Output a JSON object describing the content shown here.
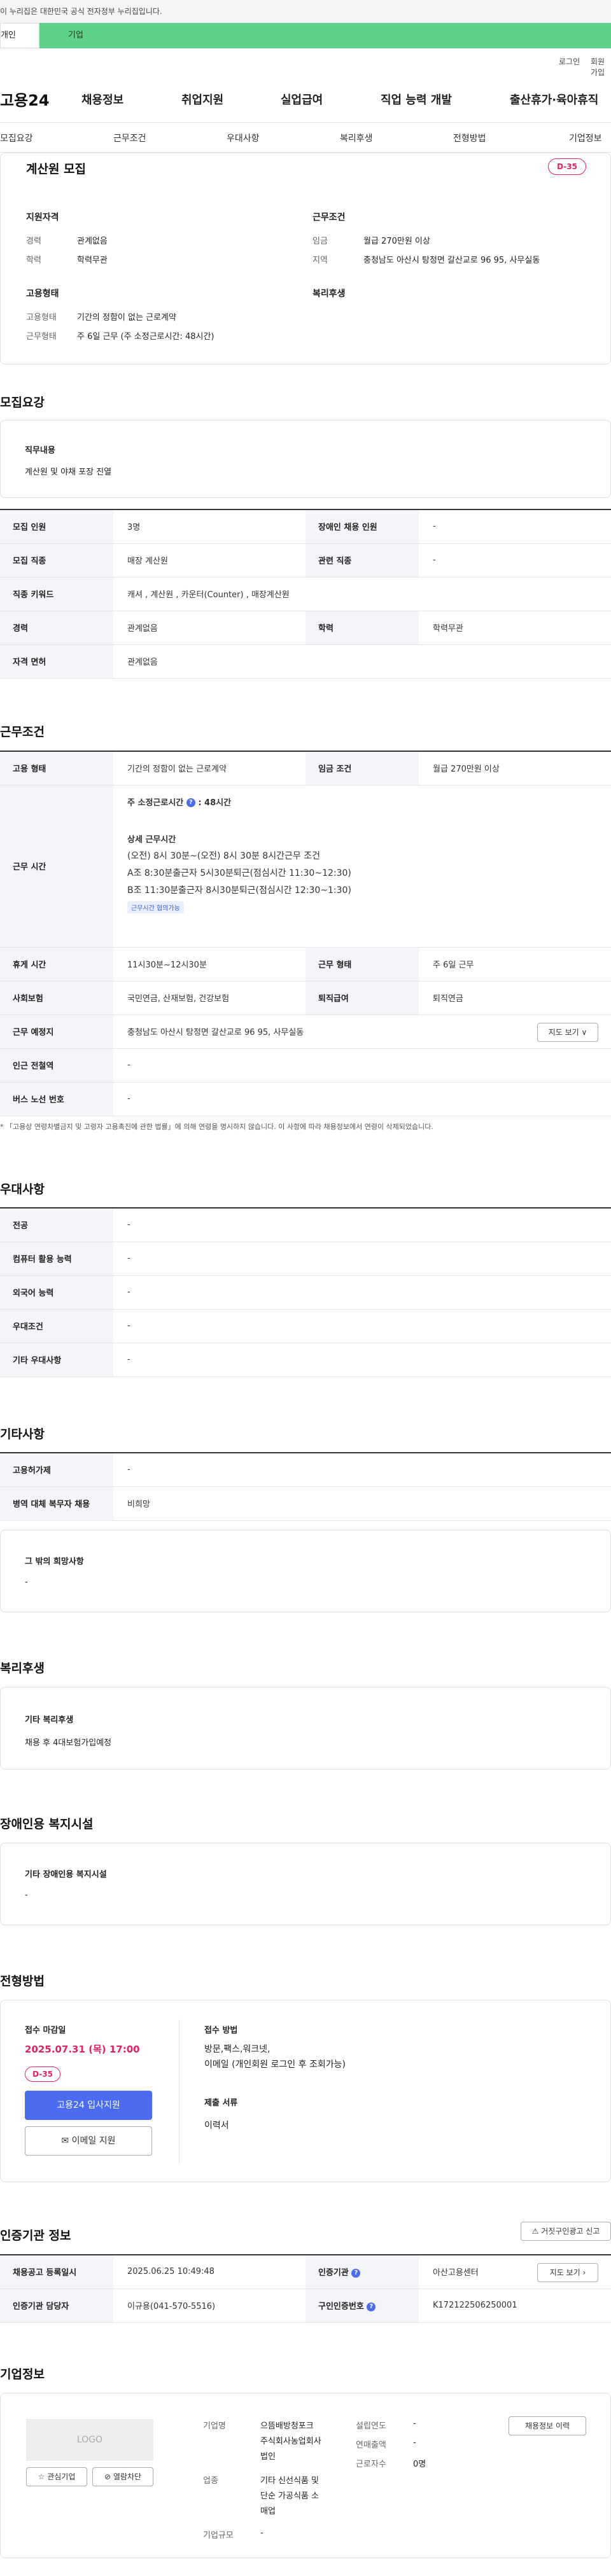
{
  "gov_notice": "이 누리집은 대한민국 공식 전자정부 누리집입니다.",
  "tabs": {
    "individual": "개인",
    "corporate": "기업"
  },
  "util": {
    "login": "로그인",
    "signup": "회원가입"
  },
  "brand": "고용24",
  "gnb": [
    "채용정보",
    "취업지원",
    "실업급여",
    "직업 능력 개발",
    "출산휴가·육아휴직"
  ],
  "subnav": [
    "모집요강",
    "근무조건",
    "우대사항",
    "복리후생",
    "전형방법",
    "기업정보"
  ],
  "summary": {
    "title": "계산원 모집",
    "dday": "D-35",
    "qualification_title": "지원자격",
    "career_label": "경력",
    "career_value": "관계없음",
    "edu_label": "학력",
    "edu_value": "학력무관",
    "condition_title": "근무조건",
    "wage_label": "임금",
    "wage_value": "월급 270만원 이상",
    "region_label": "지역",
    "region_value": "충청남도 아산시 탕정면 갈산교로 96 95, 사무실동",
    "employment_title": "고용형태",
    "emp_type_label": "고용형태",
    "emp_type_value": "기간의 정함이 없는 근로계약",
    "work_type_label": "근무형태",
    "work_type_value": "주 6일 근무 (주 소정근로시간: 48시간)",
    "welfare_title": "복리후생"
  },
  "recruit": {
    "section_title": "모집요강",
    "duty_title": "직무내용",
    "duty_value": "계산원 및 야채 포장 진열",
    "rows": [
      {
        "h1": "모집 인원",
        "v1": "3명",
        "h2": "장애인 채용 인원",
        "v2": "-"
      },
      {
        "h1": "모집 직종",
        "v1": "매장 계산원",
        "h2": "관련 직종",
        "v2": "-"
      },
      {
        "h1": "직종 키워드",
        "v1": "캐셔 , 계산원 , 카운터(Counter) , 매장계산원",
        "h2": "",
        "v2": ""
      },
      {
        "h1": "경력",
        "v1": "관계없음",
        "h2": "학력",
        "v2": "학력무관"
      },
      {
        "h1": "자격 면허",
        "v1": "관계없음",
        "h2": "",
        "v2": ""
      }
    ]
  },
  "work": {
    "section_title": "근무조건",
    "emp_type_h": "고용 형태",
    "emp_type_v": "기간의 정함이 없는 근로계약",
    "wage_h": "임금 조건",
    "wage_v": "월급 270만원 이상",
    "hours_h": "근무 시간",
    "weekly_hours": "주 소정근로시간",
    "weekly_hours_value": ": 48시간",
    "detail_title": "상세 근무시간",
    "detail_lines": [
      "(오전) 8시 30분~(오전) 8시 30분 8시간근무 조건",
      "A조 8:30분출근자 5시30분퇴근(점심시간 11:30~12:30)",
      "B조 11:30분출근자 8시30분퇴근(점심시간 12:30~1:30)"
    ],
    "flex_chip": "근무시간 협의가능",
    "break_h": "휴게 시간",
    "break_v": "11시30분~12시30분",
    "shape_h": "근무 형태",
    "shape_v": "주 6일 근무",
    "insurance_h": "사회보험",
    "insurance_v": "국민연금, 산재보험, 건강보험",
    "severance_h": "퇴직급여",
    "severance_v": "퇴직연금",
    "place_h": "근무 예정지",
    "place_v": "충청남도 아산시 탕정면 갈산교로 96 95, 사무실동",
    "map_btn": "지도 보기",
    "subway_h": "인근 전철역",
    "subway_v": "-",
    "bus_h": "버스 노선 번호",
    "bus_v": "-",
    "footnote": "* 「고용상 연령차별금지 및 고령자 고용촉진에 관한 법률」에 의해 연령을 명시하지 않습니다. 이 사항에 따라 채용정보에서 연령이 삭제되었습니다."
  },
  "pref": {
    "section_title": "우대사항",
    "rows": [
      {
        "h": "전공",
        "v": "-"
      },
      {
        "h": "컴퓨터 활용 능력",
        "v": "-"
      },
      {
        "h": "외국어 능력",
        "v": "-"
      },
      {
        "h": "우대조건",
        "v": "-"
      },
      {
        "h": "기타 우대사항",
        "v": "-"
      }
    ]
  },
  "etc": {
    "section_title": "기타사항",
    "rows": [
      {
        "h": "고용허가제",
        "v": "-"
      },
      {
        "h": "병역 대체 복무자 채용",
        "v": "비희망"
      }
    ],
    "other_title": "그 밖의 희망사항",
    "other_value": "-"
  },
  "welfare": {
    "section_title": "복리후생",
    "box_title": "기타 복리후생",
    "box_value": "채용 후 4대보험가입예정"
  },
  "disability": {
    "section_title": "장애인용 복지시설",
    "box_title": "기타 장애인용 복지시설",
    "box_value": "-"
  },
  "process": {
    "section_title": "전형방법",
    "deadline_title": "접수 마감일",
    "deadline_value": "2025.07.31 (목) 17:00",
    "dday": "D-35",
    "apply_btn": "고용24 입사지원",
    "email_btn": "이메일 지원",
    "method_title": "접수 방법",
    "method_value": "방문,팩스,워크넷,",
    "method_value2": "이메일 (개인회원 로그인 후 조회가능)",
    "docs_title": "제출 서류",
    "docs_value": "이력서"
  },
  "cert": {
    "section_title": "인증기관 정보",
    "report_btn": "거짓구인광고 신고",
    "reg_h": "채용공고 등록일시",
    "reg_v": "2025.06.25 10:49:48",
    "org_h": "인증기관",
    "org_v": "아산고용센터",
    "map_btn": "지도 보기",
    "manager_h": "인증기관 담당자",
    "manager_v": "이규용(041-570-5516)",
    "id_h": "구인인증번호",
    "id_v": "K172122506250001"
  },
  "company": {
    "section_title": "기업정보",
    "logo": "LOGO",
    "interest_btn": "관심기업",
    "block_btn": "열람차단",
    "name_label": "기업명",
    "name_value_lines": [
      "으뜸배방청포크",
      "주식회사농업회사",
      "법인"
    ],
    "industry_label": "업종",
    "industry_value_lines": [
      "기타 신선식품 및",
      "단순 가공식품 소",
      "매업"
    ],
    "scale_label": "기업규모",
    "scale_value": "-",
    "founded_label": "설립연도",
    "founded_value": "-",
    "sales_label": "연매출액",
    "sales_value": "-",
    "employees_label": "근로자수",
    "employees_value": "0명",
    "history_btn": "채용정보 이력"
  }
}
